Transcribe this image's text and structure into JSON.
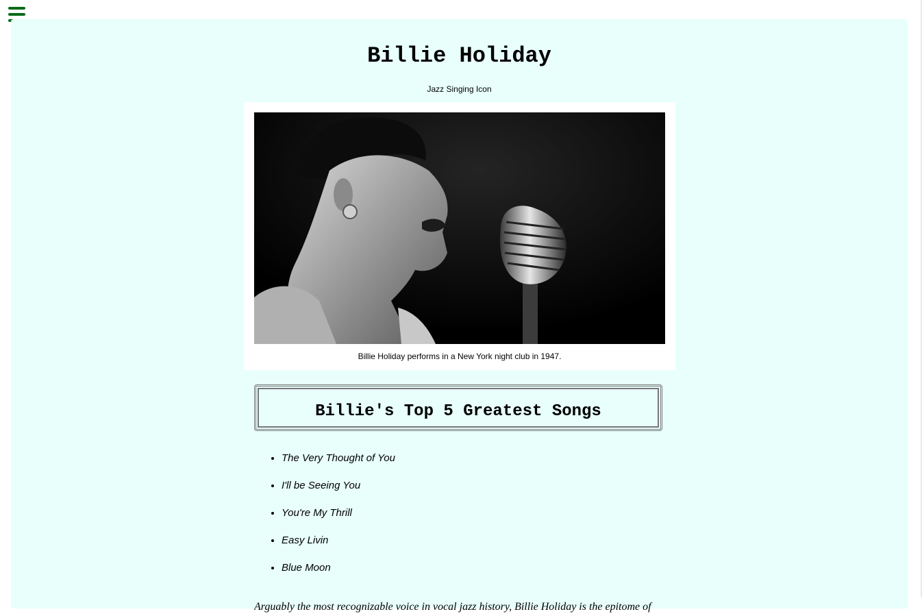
{
  "menu": {
    "icon": "hamburger-menu-icon"
  },
  "header": {
    "title": "Billie Holiday",
    "subtitle": "Jazz Singing Icon"
  },
  "figure": {
    "caption": "Billie Holiday performs in a New York night club in 1947."
  },
  "songs": {
    "heading": "Billie's Top 5 Greatest Songs",
    "items": [
      "The Very Thought of You",
      "I'll be Seeing You",
      "You're My Thrill",
      "Easy Livin",
      "Blue Moon"
    ]
  },
  "intro": {
    "text": "Arguably the most recognizable voice in vocal jazz history, Billie Holiday is the epitome of"
  },
  "colors": {
    "page_background": "#e8fffb",
    "menu_icon": "#0b6b1a"
  }
}
